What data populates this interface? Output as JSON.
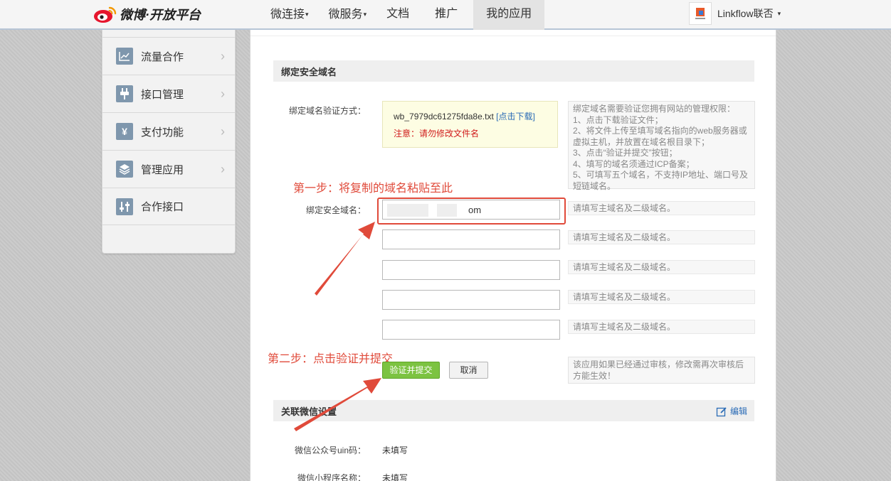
{
  "header": {
    "logo_text": "微博·开放平台",
    "nav": [
      {
        "label": "微连接",
        "caret": "▾"
      },
      {
        "label": "微服务",
        "caret": "▾"
      },
      {
        "label": "文档",
        "caret": ""
      },
      {
        "label": "推广",
        "caret": ""
      },
      {
        "label": "我的应用",
        "caret": ""
      }
    ],
    "user_name": "Linkflow联否",
    "user_caret": "▾"
  },
  "sidebar": {
    "items": [
      {
        "label": "流量合作",
        "icon": "chart-icon"
      },
      {
        "label": "接口管理",
        "icon": "plug-icon"
      },
      {
        "label": "支付功能",
        "icon": "yen-icon"
      },
      {
        "label": "管理应用",
        "icon": "layers-icon"
      },
      {
        "label": "合作接口",
        "icon": "sliders-icon"
      }
    ],
    "arrow": "›"
  },
  "domain_section": {
    "title": "绑定安全域名",
    "verify_label": "绑定域名验证方式：",
    "file_name": "wb_7979dc61275fda8e.txt",
    "download_link": "[点击下载]",
    "note": "注意：请勿修改文件名",
    "help_lines": [
      "绑定域名需要验证您拥有网站的管理权限：",
      "1、点击下载验证文件；",
      "2、将文件上传至填写域名指向的web服务器或",
      "虚拟主机，并放置在域名根目录下；",
      "3、点击“验证并提交”按钮；",
      "4、填写的域名须通过ICP备案；",
      "5、可填写五个域名，不支持IP地址、端口号及",
      "短链域名。"
    ],
    "domain_label": "绑定安全域名：",
    "domain_values": [
      "om",
      "",
      "",
      "",
      ""
    ],
    "domain_hint": "请填写主域名及二级域名。",
    "submit_label": "验证并提交",
    "cancel_label": "取消",
    "review_note": [
      "该应用如果已经通过审核，修改需再次审核后",
      "方能生效！"
    ]
  },
  "annotations": {
    "step1": "第一步：将复制的域名粘贴至此",
    "step2": "第二步：点击验证并提交"
  },
  "wechat_section": {
    "title": "关联微信设置",
    "edit_label": "编辑",
    "rows": [
      {
        "label": "微信公众号uin码：",
        "value": "未填写"
      },
      {
        "label": "微信小程序名称：",
        "value": "未填写"
      }
    ]
  },
  "colors": {
    "accent_red": "#e04a3a",
    "submit_green": "#7cc341",
    "link_blue": "#2a6bb6",
    "note_red": "#d01b1b"
  }
}
